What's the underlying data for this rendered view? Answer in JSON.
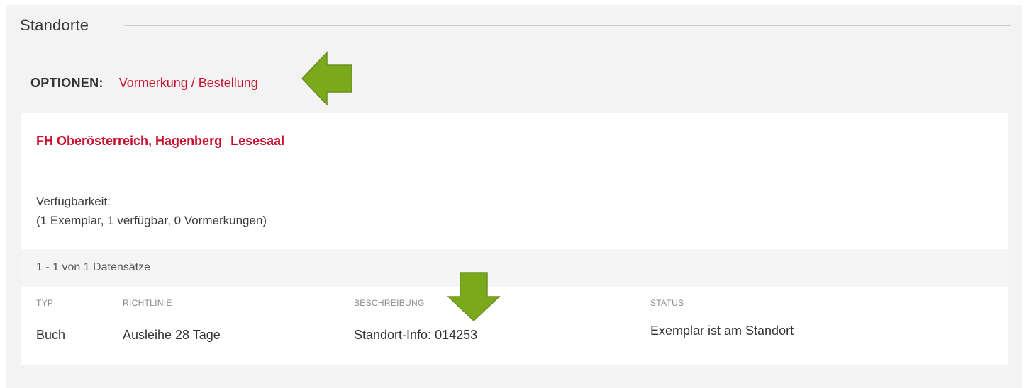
{
  "section": {
    "title": "Standorte"
  },
  "options": {
    "label": "OPTIONEN:",
    "link": "Vormerkung / Bestellung"
  },
  "location": {
    "library": "FH Oberösterreich, Hagenberg",
    "room": "Lesesaal"
  },
  "availability": {
    "label": "Verfügbarkeit:",
    "summary": "(1 Exemplar, 1 verfügbar, 0 Vormerkungen)"
  },
  "records": {
    "count_text": "1 - 1 von 1 Datensätze"
  },
  "table": {
    "headers": [
      "TYP",
      "RICHTLINIE",
      "BESCHREIBUNG",
      "STATUS"
    ],
    "rows": [
      [
        "Buch",
        "Ausleihe 28 Tage",
        "Standort-Info: 014253",
        "Exemplar ist am Standort"
      ]
    ]
  },
  "colors": {
    "accent_red": "#c8102e",
    "arrow_green": "#7aaa1a",
    "panel_bg": "#f3f3f3"
  },
  "icons": {
    "left_arrow": "arrow-left-annotation-icon",
    "down_arrow": "arrow-down-annotation-icon"
  }
}
